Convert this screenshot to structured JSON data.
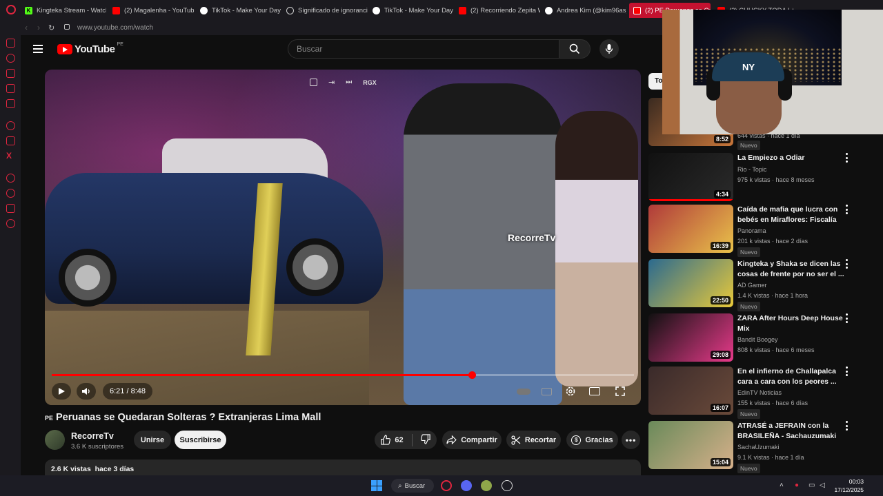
{
  "browser": {
    "tabs": [
      {
        "label": "Kingteka Stream - Watch",
        "icon": "kick-icon",
        "color": "#53fc18"
      },
      {
        "label": "(2) Magalenha - YouTube",
        "icon": "youtube-icon",
        "color": "#ff0000"
      },
      {
        "label": "TikTok - Make Your Day",
        "icon": "tiktok-icon",
        "color": "#ffffff"
      },
      {
        "label": "Significado de ignorancia",
        "icon": "globe-icon",
        "color": "#cccccc"
      },
      {
        "label": "TikTok - Make Your Day",
        "icon": "tiktok-icon",
        "color": "#ffffff"
      },
      {
        "label": "(2) Recorriendo Zepita W",
        "icon": "youtube-icon",
        "color": "#ff0000"
      },
      {
        "label": "Andrea Kim (@kim96as)",
        "icon": "tiktok-icon",
        "color": "#ffffff"
      },
      {
        "label": "(2) PE Peruanas se Qued",
        "icon": "youtube-icon",
        "color": "#ff0000"
      },
      {
        "label": "(2) CHUCKY TODA LA",
        "icon": "youtube-icon",
        "color": "#ff0000"
      }
    ],
    "url": "www.youtube.com/watch"
  },
  "header": {
    "logo_text": "YouTube",
    "country": "PE",
    "search_placeholder": "Buscar"
  },
  "player": {
    "watermark": "RecorreTv",
    "overlay_label": "RGX",
    "current_time": "6:21",
    "duration": "8:48",
    "time_display": "6:21 / 8:48",
    "progress_fraction": 0.722
  },
  "video": {
    "country_flag": "PE",
    "title": "Peruanas se Quedaran Solteras ? Extranjeras Lima Mall",
    "channel": "RecorreTv",
    "subscribers": "3.6 K suscriptores",
    "join_label": "Unirse",
    "subscribe_label": "Suscribirse",
    "likes": "62",
    "share_label": "Compartir",
    "clip_label": "Recortar",
    "thanks_label": "Gracias",
    "views": "2.6 K vistas",
    "age": "hace 3 días"
  },
  "sidebar": {
    "chip_label": "To",
    "recommendations": [
      {
        "title": "",
        "channel": "",
        "meta": "644 vistas · hace 1 día",
        "badge": "Nuevo",
        "duration": "8:52",
        "thumb": [
          "#3a2a20",
          "#c8763a"
        ],
        "progress": 0
      },
      {
        "title": "La Empiezo a Odiar",
        "channel": "Rio - Topic",
        "meta": "975 k vistas · hace 8 meses",
        "badge": "",
        "duration": "4:34",
        "thumb": [
          "#111111",
          "#2a2a2a"
        ],
        "progress": 1
      },
      {
        "title": "Caída de mafia que lucra con bebés en Miraflores: Fiscalía n...",
        "channel": "Panorama",
        "meta": "201 k vistas · hace 2 días",
        "badge": "Nuevo",
        "duration": "16:39",
        "thumb": [
          "#b03a3a",
          "#e9c24a"
        ],
        "progress": 0
      },
      {
        "title": "Kingteka y Shaka se dicen las cosas de frente por no ser el ...",
        "channel": "AD Gamer",
        "meta": "1.4 K vistas · hace 1 hora",
        "badge": "Nuevo",
        "duration": "22:50",
        "thumb": [
          "#2b6a8f",
          "#e8c93a"
        ],
        "progress": 0
      },
      {
        "title": "ZARA After Hours Deep House Mix",
        "channel": "Bandit Boogey",
        "meta": "808 k vistas · hace 6 meses",
        "badge": "",
        "duration": "29:08",
        "thumb": [
          "#111111",
          "#e73a8a"
        ],
        "progress": 0
      },
      {
        "title": "En el infierno de Challapalca cara a cara con los peores ...",
        "channel": "EdinTV Noticias",
        "meta": "155 k vistas · hace 6 días",
        "badge": "Nuevo",
        "duration": "16:07",
        "thumb": [
          "#3a2a2a",
          "#6a4a3a"
        ],
        "progress": 0
      },
      {
        "title": "ATRASÉ a JEFRAIN con la BRASILEÑA - Sachauzumaki",
        "channel": "SachaUzumaki",
        "meta": "9.1 K vistas · hace 1 día",
        "badge": "Nuevo",
        "duration": "15:04",
        "thumb": [
          "#6a8a5a",
          "#d6b08a"
        ],
        "progress": 0
      }
    ]
  },
  "webcam": {
    "cap_logo": "NY"
  },
  "taskbar": {
    "search_label": "Buscar",
    "time": "00:03",
    "date": "17/12/2025"
  }
}
